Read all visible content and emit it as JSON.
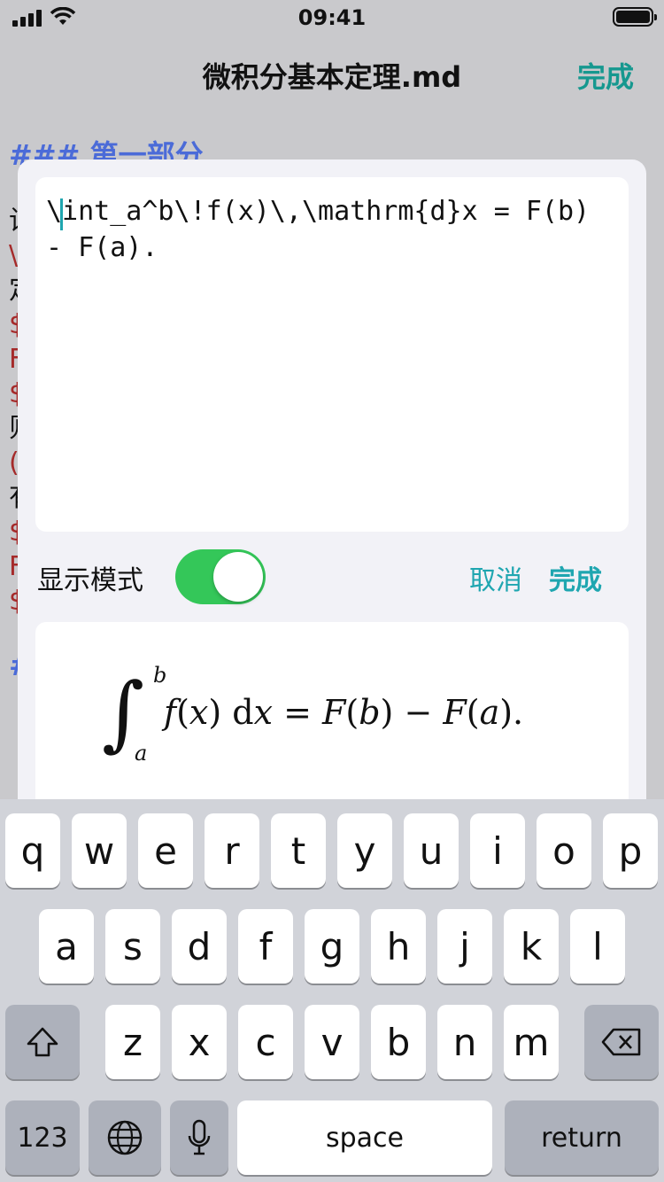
{
  "status": {
    "time": "09:41"
  },
  "nav": {
    "title": "微积分基本定理.md",
    "done": "完成"
  },
  "doc": {
    "heading": "### 第一部分",
    "lines": [
      {
        "text": "设",
        "color": "#111111"
      },
      {
        "text": "\\",
        "color": "#a52a2a"
      },
      {
        "text": "定",
        "color": "#111111"
      },
      {
        "text": "$",
        "color": "#a52a2a"
      },
      {
        "text": "F",
        "color": "#a52a2a"
      },
      {
        "text": "$",
        "color": "#a52a2a"
      },
      {
        "text": "则",
        "color": "#111111"
      },
      {
        "text": "(",
        "color": "#a52a2a"
      },
      {
        "text": "有",
        "color": "#111111"
      },
      {
        "text": "$",
        "color": "#a52a2a"
      },
      {
        "text": "F",
        "color": "#a52a2a"
      },
      {
        "text": "$",
        "color": "#a52a2a"
      }
    ],
    "heading2": "#"
  },
  "editor": {
    "latex": "\\int_a^b\\!f(x)\\,\\mathrm{d}x = F(b) - F(a)."
  },
  "display_mode": {
    "label": "显示模式",
    "on": true
  },
  "actions": {
    "cancel": "取消",
    "done": "完成"
  },
  "preview": {
    "integral": "∫",
    "upper": "b",
    "lower": "a",
    "f": "f",
    "x1": "x",
    "d": "d",
    "x2": "x",
    "F1": "F",
    "b": "b",
    "F2": "F",
    "a": "a"
  },
  "keyboard": {
    "row1": [
      "q",
      "w",
      "e",
      "r",
      "t",
      "y",
      "u",
      "i",
      "o",
      "p"
    ],
    "row2": [
      "a",
      "s",
      "d",
      "f",
      "g",
      "h",
      "j",
      "k",
      "l"
    ],
    "row3": [
      "z",
      "x",
      "c",
      "v",
      "b",
      "n",
      "m"
    ],
    "numbers": "123",
    "space": "space",
    "return": "return"
  },
  "colors": {
    "accent": "#1fa6b0",
    "toggle_on": "#34c759",
    "heading_blue": "#4b6bd8"
  }
}
